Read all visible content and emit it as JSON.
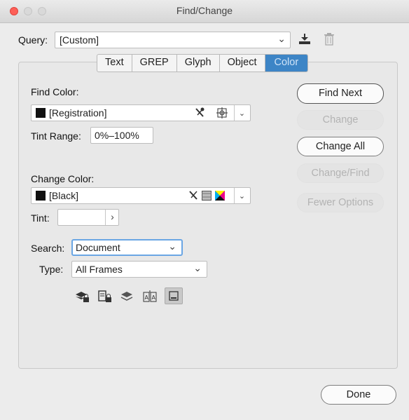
{
  "window": {
    "title": "Find/Change"
  },
  "query": {
    "label": "Query:",
    "value": "[Custom]"
  },
  "tabs": [
    "Text",
    "GREP",
    "Glyph",
    "Object",
    "Color"
  ],
  "active_tab": "Color",
  "find_color": {
    "label": "Find Color:",
    "value": "[Registration]"
  },
  "tint_range": {
    "label": "Tint Range:",
    "value": "0%–100%"
  },
  "change_color": {
    "label": "Change Color:",
    "value": "[Black]"
  },
  "tint": {
    "label": "Tint:",
    "value": ""
  },
  "search": {
    "label": "Search:",
    "value": "Document"
  },
  "type": {
    "label": "Type:",
    "value": "All Frames"
  },
  "buttons": {
    "find_next": "Find Next",
    "change": "Change",
    "change_all": "Change All",
    "change_find": "Change/Find",
    "fewer_options": "Fewer Options",
    "done": "Done"
  },
  "glyphs": {
    "chevron_down": "⌄",
    "chevron_right": "›",
    "eyedropper": "✕"
  },
  "colors": {
    "accent": "#3d85c6",
    "close": "#fd5f57"
  }
}
